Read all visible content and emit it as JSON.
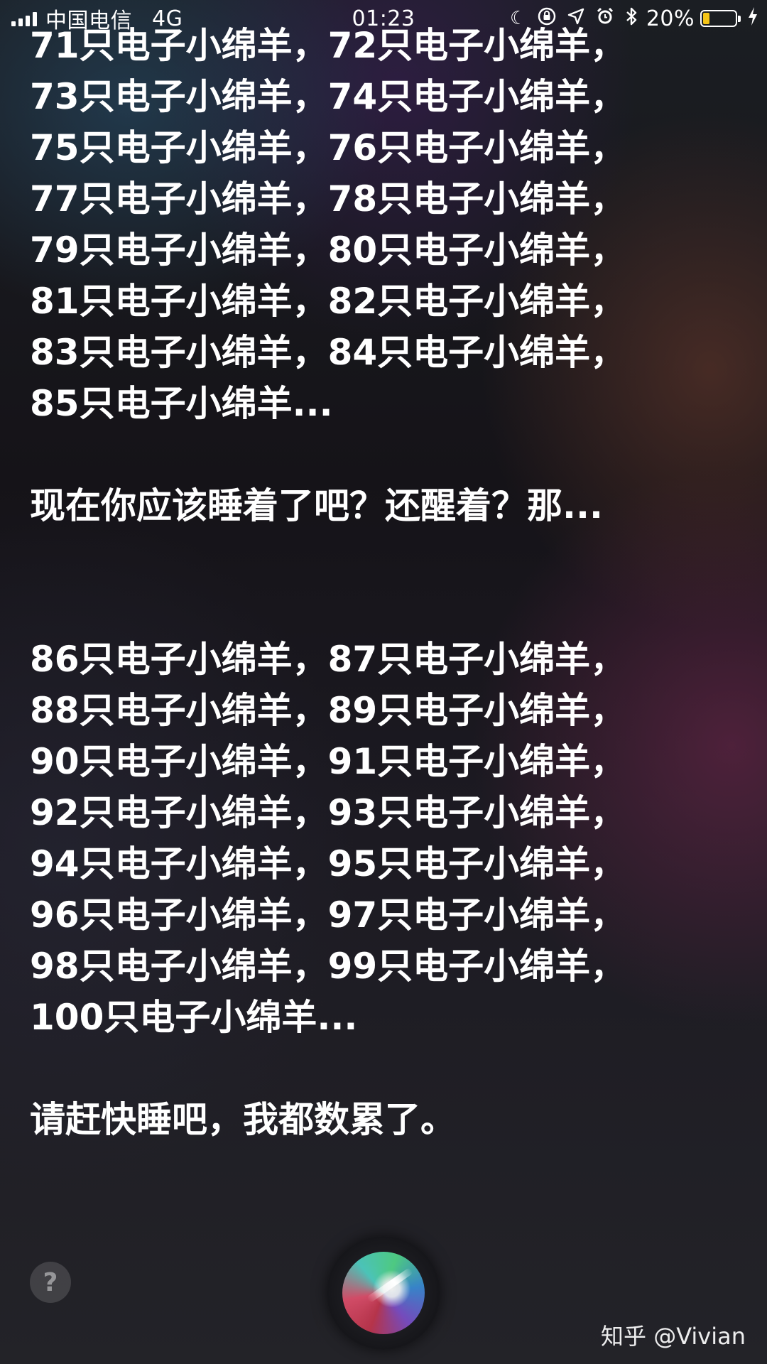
{
  "status_bar": {
    "carrier": "中国电信",
    "network": "4G",
    "time": "01:23",
    "battery_percent": "20%",
    "battery_level": 0.2,
    "battery_color": "#f5c518",
    "icons": [
      "signal-icon",
      "moon-icon",
      "rotation-lock-icon",
      "location-icon",
      "alarm-icon",
      "bluetooth-icon",
      "battery-icon",
      "charging-icon"
    ]
  },
  "siri": {
    "lines_top": [
      "71只电子小绵羊，72只电子小绵羊，",
      "73只电子小绵羊，74只电子小绵羊，",
      "75只电子小绵羊，76只电子小绵羊，",
      "77只电子小绵羊，78只电子小绵羊，",
      "79只电子小绵羊，80只电子小绵羊，",
      "81只电子小绵羊，82只电子小绵羊，",
      "83只电子小绵羊，84只电子小绵羊，",
      "85只电子小绵羊..."
    ],
    "question": "现在你应该睡着了吧？还醒着？那...",
    "lines_bottom": [
      "86只电子小绵羊，87只电子小绵羊，",
      "88只电子小绵羊，89只电子小绵羊，",
      "90只电子小绵羊，91只电子小绵羊，",
      "92只电子小绵羊，93只电子小绵羊，",
      "94只电子小绵羊，95只电子小绵羊，",
      "96只电子小绵羊，97只电子小绵羊，",
      "98只电子小绵羊，99只电子小绵羊，",
      "100只电子小绵羊..."
    ],
    "closing": "请赶快睡吧，我都数累了。"
  },
  "help_button": {
    "label": "?"
  },
  "watermark": "知乎 @Vivian"
}
